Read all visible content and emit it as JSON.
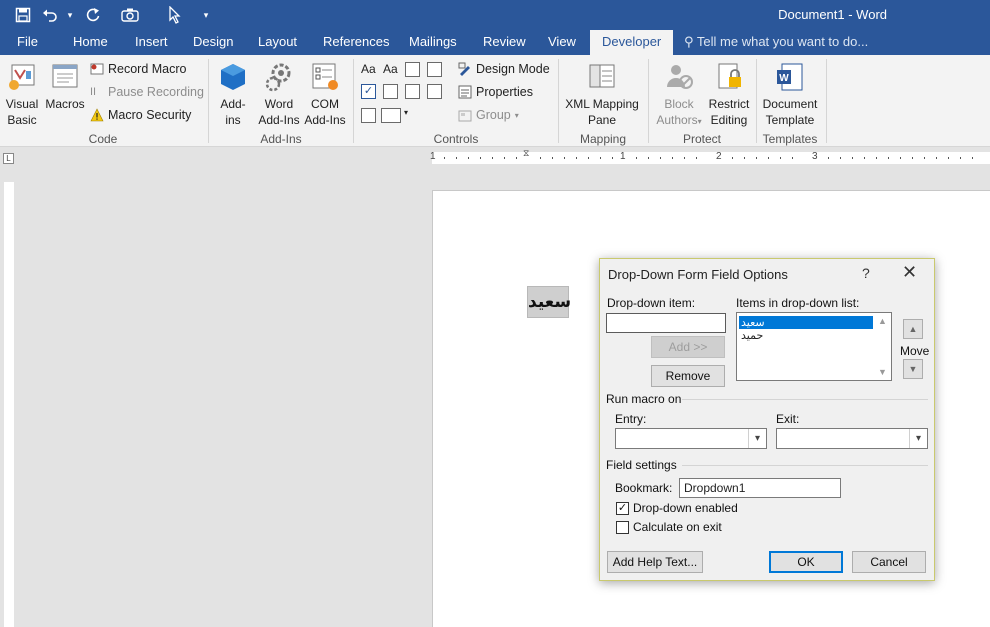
{
  "window": {
    "title": "Document1 - Word"
  },
  "qat": {
    "more": "▾"
  },
  "tabs": [
    {
      "label": "File"
    },
    {
      "label": "Home"
    },
    {
      "label": "Insert"
    },
    {
      "label": "Design"
    },
    {
      "label": "Layout"
    },
    {
      "label": "References"
    },
    {
      "label": "Mailings"
    },
    {
      "label": "Review"
    },
    {
      "label": "View"
    },
    {
      "label": "Developer"
    }
  ],
  "tellme": "Tell me what you want to do...",
  "ribbon": {
    "code": {
      "label": "Code",
      "visual_basic": [
        "Visual",
        "Basic"
      ],
      "macros": "Macros",
      "record_macro": "Record Macro",
      "pause_recording": "Pause Recording",
      "macro_security": "Macro Security"
    },
    "addins": {
      "label": "Add-Ins",
      "addins": [
        "Add-",
        "ins"
      ],
      "word_addins": [
        "Word",
        "Add-Ins"
      ],
      "com_addins": [
        "COM",
        "Add-Ins"
      ]
    },
    "controls": {
      "label": "Controls",
      "design_mode": "Design Mode",
      "properties": "Properties",
      "group": "Group"
    },
    "mapping": {
      "label": "Mapping",
      "xml_pane": [
        "XML Mapping",
        "Pane"
      ]
    },
    "protect": {
      "label": "Protect",
      "block_authors": [
        "Block",
        "Authors"
      ],
      "restrict_editing": [
        "Restrict",
        "Editing"
      ]
    },
    "templates": {
      "label": "Templates",
      "document_template": [
        "Document",
        "Template"
      ]
    }
  },
  "ruler": {
    "numbers": [
      "1",
      "1",
      "2",
      "3"
    ],
    "corner": "L"
  },
  "document": {
    "form_field_text": "سعيد"
  },
  "dialog": {
    "title": "Drop-Down Form Field Options",
    "help": "?",
    "close": "✕",
    "dropdown_item_label": "Drop-down item:",
    "dropdown_item_value": "",
    "items_label": "Items in drop-down list:",
    "items": [
      "سعيد",
      "حميد"
    ],
    "selected_index": 0,
    "add_button": "Add >>",
    "remove_button": "Remove",
    "move_label": "Move",
    "run_macro_label": "Run macro on",
    "entry_label": "Entry:",
    "entry_value": "",
    "exit_label": "Exit:",
    "exit_value": "",
    "field_settings_label": "Field settings",
    "bookmark_label": "Bookmark:",
    "bookmark_value": "Dropdown1",
    "dropdown_enabled_label": "Drop-down enabled",
    "dropdown_enabled_checked": true,
    "calculate_on_exit_label": "Calculate on exit",
    "calculate_on_exit_checked": false,
    "add_help_text_button": "Add Help Text...",
    "ok_button": "OK",
    "cancel_button": "Cancel"
  },
  "colors": {
    "accent": "#2b579a",
    "selection": "#0078d7"
  }
}
